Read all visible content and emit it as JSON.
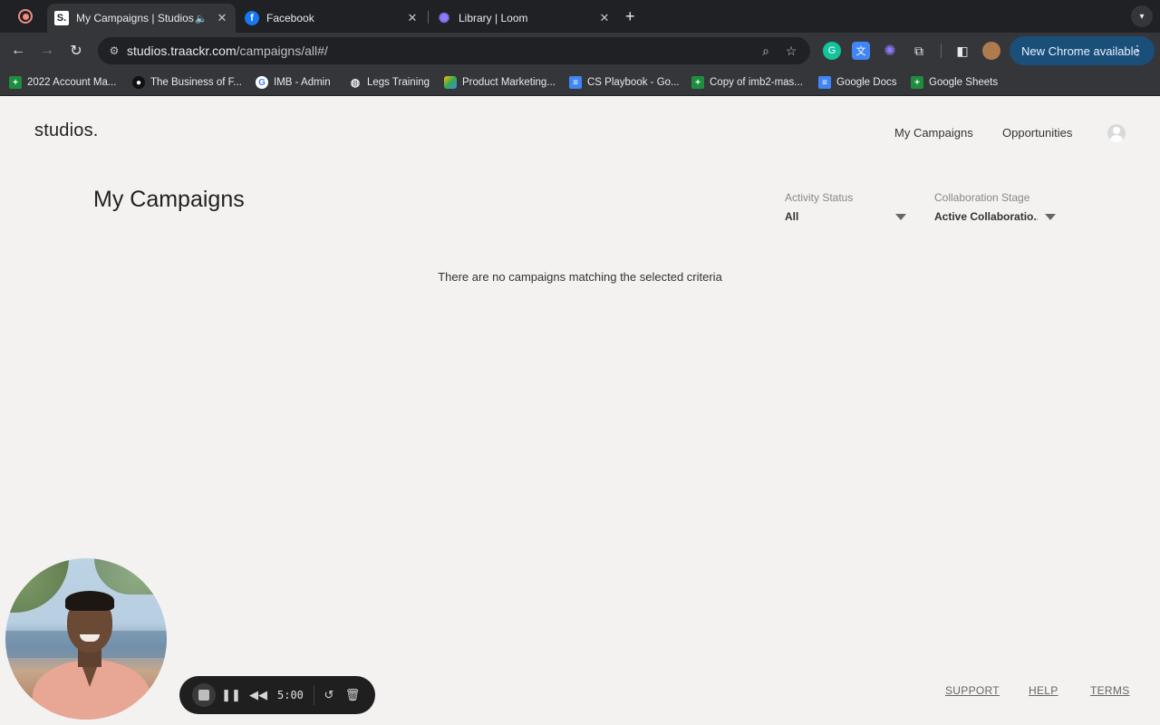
{
  "browser": {
    "tabs": [
      {
        "title": "My Campaigns | Studios",
        "favicon": "S.",
        "active": true
      },
      {
        "title": "Facebook",
        "favicon": "f",
        "active": false
      },
      {
        "title": "Library | Loom",
        "favicon": "loom-icon",
        "active": false
      }
    ],
    "url_domain": "studios.traackr.com",
    "url_path": "/campaigns/all#/",
    "update_label": "New Chrome available",
    "bookmarks": [
      {
        "label": "2022 Account Ma...",
        "icon": "sheets-icon"
      },
      {
        "label": "The Business of F...",
        "icon": "bof-icon"
      },
      {
        "label": "IMB - Admin",
        "icon": "google-icon"
      },
      {
        "label": "Legs Training",
        "icon": "globe-icon"
      },
      {
        "label": "Product Marketing...",
        "icon": "drive-icon"
      },
      {
        "label": "CS Playbook - Go...",
        "icon": "docs-icon"
      },
      {
        "label": "Copy of imb2-mas...",
        "icon": "sheets-icon"
      },
      {
        "label": "Google Docs",
        "icon": "docs-icon"
      },
      {
        "label": "Google Sheets",
        "icon": "sheets-icon"
      }
    ]
  },
  "app": {
    "logo": "studios.",
    "nav": {
      "my_campaigns": "My Campaigns",
      "opportunities": "Opportunities"
    },
    "page_title": "My Campaigns",
    "filters": {
      "activity_status": {
        "label": "Activity Status",
        "value": "All"
      },
      "collaboration_stage": {
        "label": "Collaboration Stage",
        "value": "Active Collaboratio..."
      }
    },
    "empty_message": "There are no campaigns matching the selected criteria",
    "footer": {
      "support": "SUPPORT",
      "help": "HELP",
      "terms": "TERMS"
    }
  },
  "loom": {
    "timer": "5:00"
  },
  "colors": {
    "page_bg": "#f4f2f1",
    "chrome_dark": "#202124",
    "chrome_toolbar": "#35363a",
    "update_button": "#1a4f7a"
  }
}
